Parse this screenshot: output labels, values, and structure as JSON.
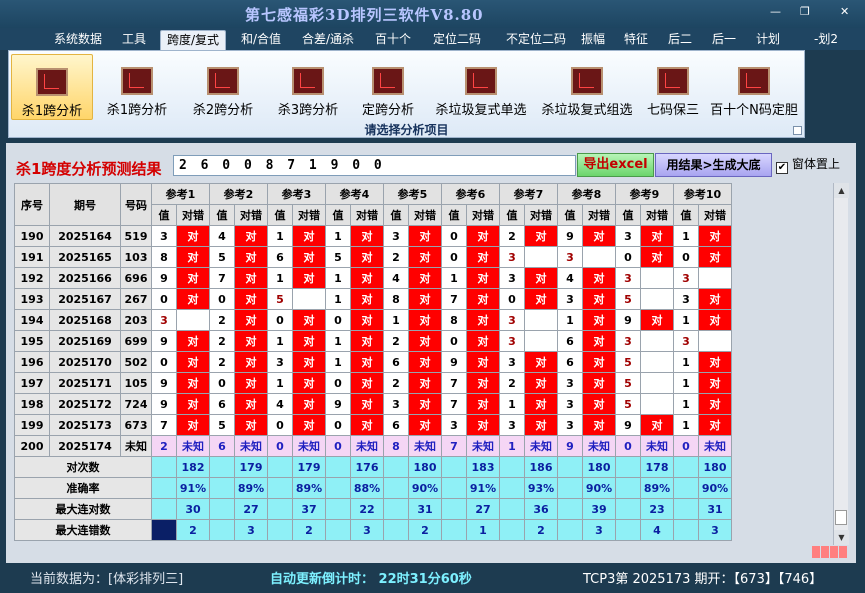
{
  "window": {
    "title": "第七感福彩3D排列三软件V8.80",
    "min": "—",
    "restore": "❐",
    "close": "✕"
  },
  "menu": [
    "系统数据",
    "工具",
    "跨度/复式",
    "和/合值",
    "合差/通杀",
    "百十个",
    "定位二码",
    "不定位二码",
    "振幅",
    "特征",
    "后二",
    "后一",
    "计划",
    "-划2"
  ],
  "menu_active": 2,
  "ribbon": {
    "buttons": [
      "杀1跨分析",
      "杀1跨分析",
      "杀2跨分析",
      "杀3跨分析",
      "定跨分析",
      "杀垃圾复式单选",
      "杀垃圾复式组选",
      "七码保三",
      "百十个N码定胆"
    ],
    "group_label": "请选择分析项目"
  },
  "result": {
    "title": "杀1跨度分析预测结果",
    "input_value": "2 6 0 0 8 7 1 9 0 0",
    "export_btn": "导出excel",
    "gen_btn": "用结果>生成大底",
    "ontop_label": "窗体置上",
    "ontop_checked": "✔"
  },
  "table": {
    "headers": {
      "seq": "序号",
      "issue": "期号",
      "code": "号码",
      "refs": [
        "参考1",
        "参考2",
        "参考3",
        "参考4",
        "参考5",
        "参考6",
        "参考7",
        "参考8",
        "参考9",
        "参考10"
      ],
      "val": "值",
      "match": "对错"
    },
    "rows": [
      {
        "seq": "190",
        "issue": "2025164",
        "code": "519",
        "vals": [
          "3",
          "4",
          "1",
          "1",
          "3",
          "0",
          "2",
          "9",
          "3",
          "1"
        ],
        "marks": [
          "对",
          "对",
          "对",
          "对",
          "对",
          "对",
          "对",
          "对",
          "对",
          "对"
        ]
      },
      {
        "seq": "191",
        "issue": "2025165",
        "code": "103",
        "vals": [
          "8",
          "5",
          "6",
          "5",
          "2",
          "0",
          "3",
          "3",
          "0",
          "0"
        ],
        "marks": [
          "对",
          "对",
          "对",
          "对",
          "对",
          "对",
          "",
          "",
          "对",
          "对"
        ]
      },
      {
        "seq": "192",
        "issue": "2025166",
        "code": "696",
        "vals": [
          "9",
          "7",
          "1",
          "1",
          "4",
          "1",
          "3",
          "4",
          "3",
          "3"
        ],
        "marks": [
          "对",
          "对",
          "对",
          "对",
          "对",
          "对",
          "对",
          "对",
          "",
          ""
        ]
      },
      {
        "seq": "193",
        "issue": "2025167",
        "code": "267",
        "vals": [
          "0",
          "0",
          "5",
          "1",
          "8",
          "7",
          "0",
          "3",
          "5",
          "3"
        ],
        "marks": [
          "对",
          "对",
          "",
          "对",
          "对",
          "对",
          "对",
          "对",
          "",
          "对"
        ]
      },
      {
        "seq": "194",
        "issue": "2025168",
        "code": "203",
        "vals": [
          "3",
          "2",
          "0",
          "0",
          "1",
          "8",
          "3",
          "1",
          "9",
          "1"
        ],
        "marks": [
          "",
          "对",
          "对",
          "对",
          "对",
          "对",
          "",
          "对",
          "对",
          "对"
        ]
      },
      {
        "seq": "195",
        "issue": "2025169",
        "code": "699",
        "vals": [
          "9",
          "2",
          "1",
          "1",
          "2",
          "0",
          "3",
          "6",
          "3",
          "3"
        ],
        "marks": [
          "对",
          "对",
          "对",
          "对",
          "对",
          "对",
          "",
          "对",
          "",
          ""
        ]
      },
      {
        "seq": "196",
        "issue": "2025170",
        "code": "502",
        "vals": [
          "0",
          "2",
          "3",
          "1",
          "6",
          "9",
          "3",
          "6",
          "5",
          "1"
        ],
        "marks": [
          "对",
          "对",
          "对",
          "对",
          "对",
          "对",
          "对",
          "对",
          "",
          "对"
        ]
      },
      {
        "seq": "197",
        "issue": "2025171",
        "code": "105",
        "vals": [
          "9",
          "0",
          "1",
          "0",
          "2",
          "7",
          "2",
          "3",
          "5",
          "1"
        ],
        "marks": [
          "对",
          "对",
          "对",
          "对",
          "对",
          "对",
          "对",
          "对",
          "",
          "对"
        ]
      },
      {
        "seq": "198",
        "issue": "2025172",
        "code": "724",
        "vals": [
          "9",
          "6",
          "4",
          "9",
          "3",
          "7",
          "1",
          "3",
          "5",
          "1"
        ],
        "marks": [
          "对",
          "对",
          "对",
          "对",
          "对",
          "对",
          "对",
          "对",
          "",
          "对"
        ]
      },
      {
        "seq": "199",
        "issue": "2025173",
        "code": "673",
        "vals": [
          "7",
          "5",
          "0",
          "0",
          "6",
          "3",
          "3",
          "3",
          "9",
          "1"
        ],
        "marks": [
          "对",
          "对",
          "对",
          "对",
          "对",
          "对",
          "对",
          "对",
          "对",
          "对"
        ]
      }
    ],
    "predict": {
      "seq": "200",
      "issue": "2025174",
      "code": "未知",
      "vals": [
        "2",
        "6",
        "0",
        "0",
        "8",
        "7",
        "1",
        "9",
        "0",
        "0"
      ],
      "mark": "未知"
    },
    "stats": [
      {
        "label": "对次数",
        "values": [
          "182",
          "179",
          "179",
          "176",
          "180",
          "183",
          "186",
          "180",
          "178",
          "180"
        ]
      },
      {
        "label": "准确率",
        "values": [
          "91%",
          "89%",
          "89%",
          "88%",
          "90%",
          "91%",
          "93%",
          "90%",
          "89%",
          "90%"
        ]
      },
      {
        "label": "最大连对数",
        "values": [
          "30",
          "27",
          "37",
          "22",
          "31",
          "27",
          "36",
          "39",
          "23",
          "31"
        ]
      },
      {
        "label": "最大连错数",
        "values": [
          "2",
          "3",
          "2",
          "3",
          "2",
          "1",
          "2",
          "3",
          "4",
          "3"
        ]
      }
    ]
  },
  "status": {
    "data_source": "当前数据为：[体彩排列三]",
    "timer": "自动更新倒计时： 22时31分60秒",
    "tcp": "TCP3第 2025173 期开：【673】【746】"
  },
  "colors": {
    "hit": "#ff0000",
    "stat_bg": "#8ff0f6",
    "predict_bg": "#f5d6f5",
    "title_red": "#d40000"
  }
}
